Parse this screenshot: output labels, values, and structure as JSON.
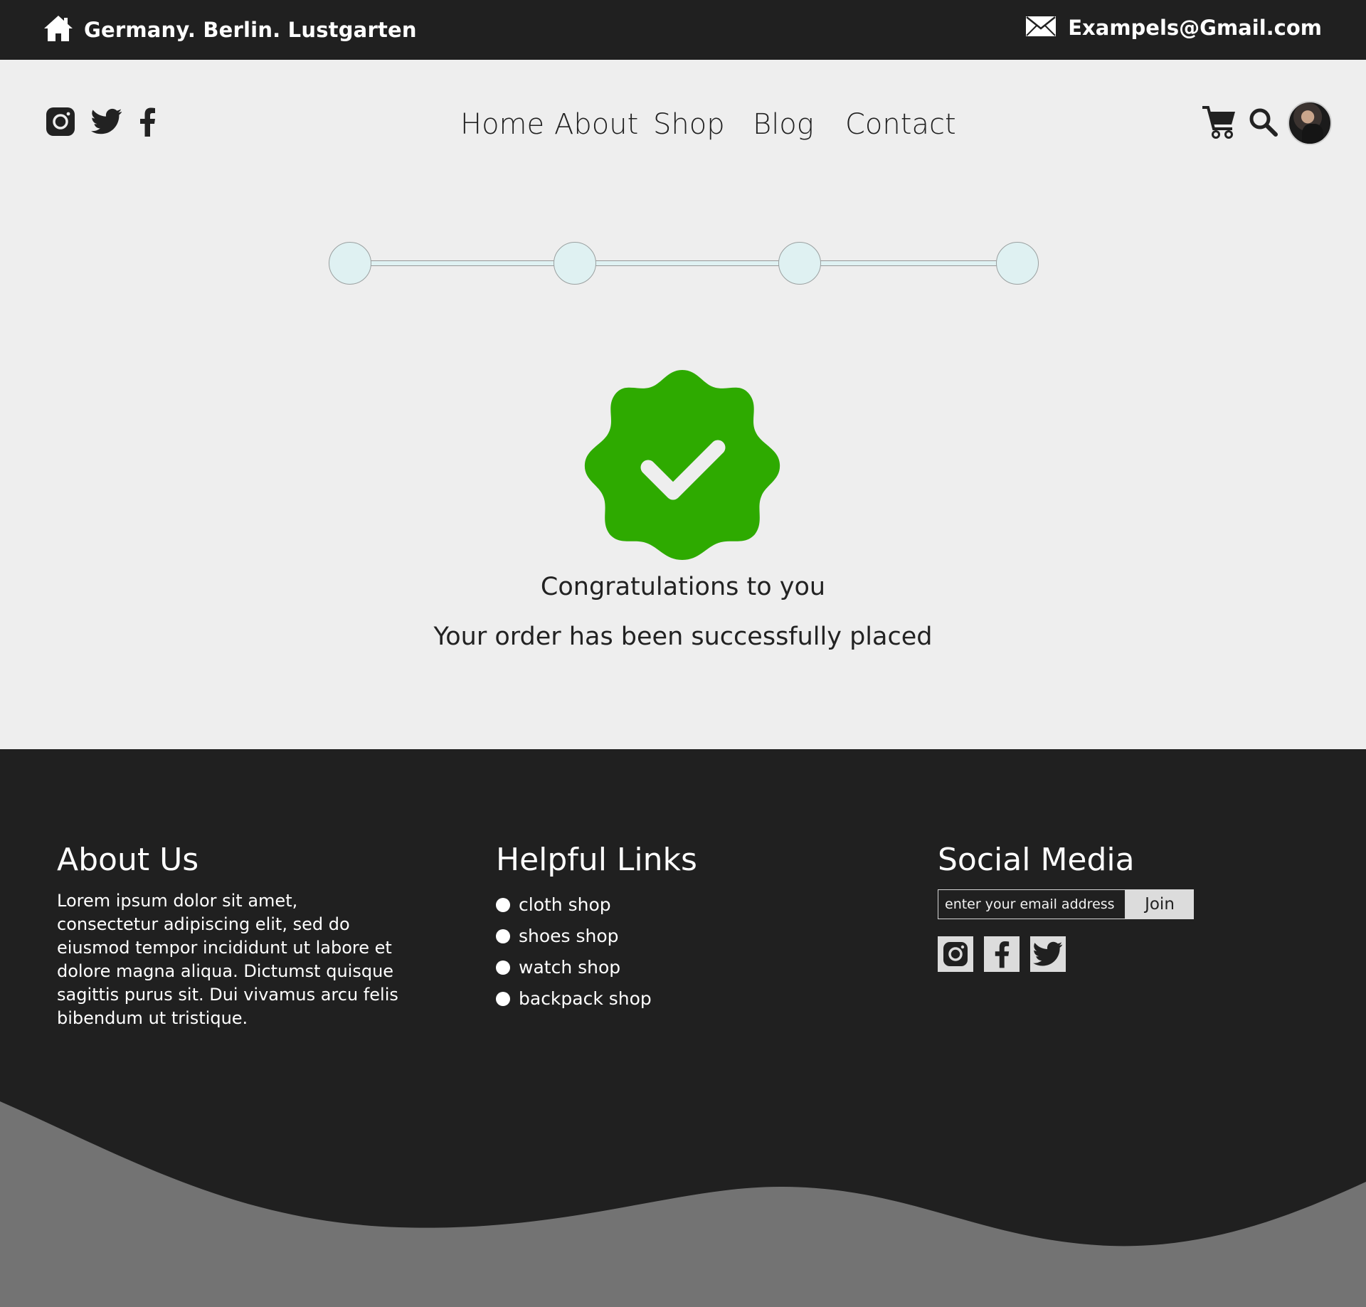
{
  "topbar": {
    "address": "Germany. Berlin. Lustgarten",
    "email": "Exampels@Gmail.com",
    "home_icon": "home-icon",
    "mail_icon": "envelope-icon"
  },
  "header": {
    "social_icons": [
      "instagram-icon",
      "twitter-icon",
      "facebook-icon"
    ],
    "nav": {
      "home": "Home",
      "about": "About",
      "shop": "Shop",
      "blog": "Blog",
      "contact": "Contact"
    },
    "right_icons": [
      "cart-icon",
      "search-icon",
      "avatar"
    ]
  },
  "stepper": {
    "steps": 4,
    "completed": 0
  },
  "confirmation": {
    "icon": "verified-check-badge-icon",
    "title": "Congratulations to you",
    "message": "Your order has been successfully placed"
  },
  "footer": {
    "about": {
      "heading": "About Us",
      "text": "Lorem ipsum dolor sit amet, consectetur adipiscing elit, sed do eiusmod tempor incididunt ut labore et dolore magna aliqua. Dictumst quisque sagittis purus sit. Dui vivamus arcu felis bibendum ut tristique."
    },
    "links": {
      "heading": "Helpful Links",
      "items": [
        "cloth shop",
        "shoes shop",
        "watch shop",
        "backpack shop"
      ]
    },
    "social": {
      "heading": "Social Media",
      "email_placeholder": "enter your email address ...",
      "join_label": "Join",
      "icons": [
        "instagram-icon",
        "facebook-icon",
        "twitter-icon"
      ]
    }
  },
  "colors": {
    "dark": "#202020",
    "page_bg": "#eeeeee",
    "success_green": "#2eaa00",
    "step_fill": "#dff1f2",
    "wave_gray": "#737373"
  }
}
